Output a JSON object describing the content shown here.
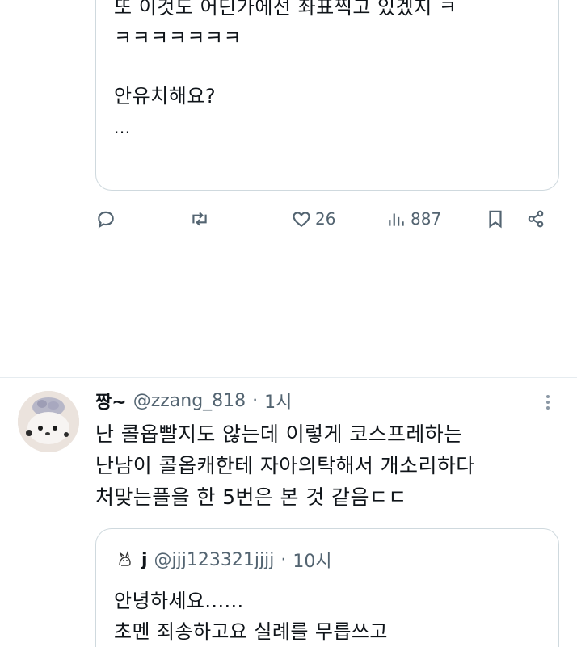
{
  "top_quote": {
    "lines": [
      "또 이것도 어딘가에선 좌표찍고 있겠지 ㅋ",
      "ㅋㅋㅋㅋㅋㅋㅋ",
      "안유치해요?",
      "..."
    ]
  },
  "actions": {
    "reply": {
      "icon": "reply-icon"
    },
    "retweet": {
      "icon": "retweet-icon"
    },
    "like": {
      "icon": "heart-icon",
      "count": "26"
    },
    "views": {
      "icon": "views-icon",
      "count": "887"
    },
    "bookmark": {
      "icon": "bookmark-icon"
    },
    "share": {
      "icon": "share-icon"
    }
  },
  "post": {
    "name": "짱~",
    "handle": "@zzang_818",
    "separator": "·",
    "time": "1시",
    "lines": [
      "난 콜옵빨지도 않는데 이렇게 코스프레하는",
      "난남이 콜옵캐한테 자아의탁해서 개소리하다",
      "처맞는플을 한 5번은 본 것 같음ㄷㄷ"
    ]
  },
  "quoted": {
    "name": "j",
    "handle": "@jjj123321jjjj",
    "separator": "·",
    "time": "10시",
    "lines": [
      "안녕하세요......",
      "초멘 죄송하고요 실례를 무릅쓰고"
    ]
  },
  "colors": {
    "text": "#0f1419",
    "muted": "#536471",
    "border": "#cfd9de"
  }
}
